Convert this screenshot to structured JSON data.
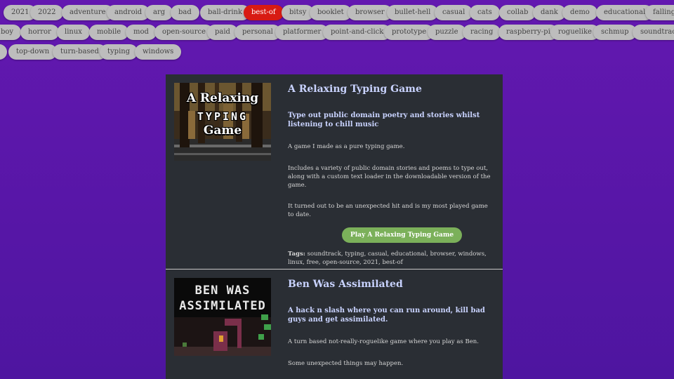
{
  "tag_bar": {
    "tags": [
      {
        "label": "2021",
        "active": false
      },
      {
        "label": "2022",
        "active": false
      },
      {
        "label": "adventure",
        "active": false
      },
      {
        "label": "android",
        "active": false
      },
      {
        "label": "arg",
        "active": false
      },
      {
        "label": "bad",
        "active": false
      },
      {
        "label": "ball-drink",
        "active": false
      },
      {
        "label": "best-of",
        "active": true
      },
      {
        "label": "bitsy",
        "active": false
      },
      {
        "label": "booklet",
        "active": false
      },
      {
        "label": "browser",
        "active": false
      },
      {
        "label": "bullet-hell",
        "active": false
      },
      {
        "label": "casual",
        "active": false
      },
      {
        "label": "cats",
        "active": false
      },
      {
        "label": "collab",
        "active": false
      },
      {
        "label": "dank",
        "active": false
      },
      {
        "label": "demo",
        "active": false
      },
      {
        "label": "educational",
        "active": false
      },
      {
        "label": "falling-",
        "active": false
      },
      {
        "label": "boy",
        "active": false
      },
      {
        "label": "horror",
        "active": false
      },
      {
        "label": "linux",
        "active": false
      },
      {
        "label": "mobile",
        "active": false
      },
      {
        "label": "mod",
        "active": false
      },
      {
        "label": "open-source",
        "active": false
      },
      {
        "label": "paid",
        "active": false
      },
      {
        "label": "personal",
        "active": false
      },
      {
        "label": "platformer",
        "active": false
      },
      {
        "label": "point-and-click",
        "active": false
      },
      {
        "label": "prototype",
        "active": false
      },
      {
        "label": "puzzle",
        "active": false
      },
      {
        "label": "racing",
        "active": false
      },
      {
        "label": "raspberry-pi",
        "active": false
      },
      {
        "label": "roguelike",
        "active": false
      },
      {
        "label": "schmup",
        "active": false
      },
      {
        "label": "soundtrack",
        "active": false
      },
      {
        "label": "",
        "active": false
      },
      {
        "label": "top-down",
        "active": false
      },
      {
        "label": "turn-based",
        "active": false
      },
      {
        "label": "typing",
        "active": false
      },
      {
        "label": "windows",
        "active": false
      }
    ]
  },
  "games": [
    {
      "title": "A Relaxing Typing Game",
      "subtitle": "Type out public domain poetry and stories whilst listening to chill music",
      "paragraphs": [
        "A game I made as a pure typing game.",
        "Includes a variety of public domain stories and poems to type out, along with a custom text loader in the downloadable version of the game.",
        "It turned out to be an unexpected hit and is my most played game to date."
      ],
      "play_label": "Play A Relaxing Typing Game",
      "tags_label": "Tags:",
      "tags_value": "soundtrack, typing, casual, educational, browser, windows, linux, free, open-source, 2021, best-of",
      "thumb_lines": [
        "A Relaxing",
        "TYPING",
        "Game"
      ]
    },
    {
      "title": "Ben Was Assimilated",
      "subtitle": "A hack n slash where you can run around, kill bad guys and get assimilated.",
      "paragraphs": [
        "A turn based not-really-roguelike game where you play as Ben.",
        "Some unexpected things may happen."
      ],
      "thumb_lines": [
        "BEN WAS",
        "ASSIMILATED"
      ]
    }
  ]
}
